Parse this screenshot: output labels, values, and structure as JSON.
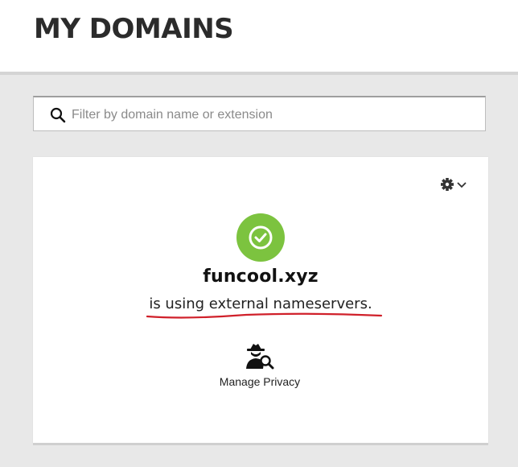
{
  "header": {
    "title": "MY DOMAINS"
  },
  "search": {
    "placeholder": "Filter by domain name or extension",
    "icon": "search-icon"
  },
  "domain_card": {
    "domain": "funcool.xyz",
    "status_text": "is using external nameservers.",
    "status_icon": "check-circle-icon",
    "status_color": "#7cc33f",
    "settings_icon": "gear-icon",
    "actions": [
      {
        "label": "Manage Privacy",
        "icon": "spy-search-icon"
      }
    ]
  },
  "colors": {
    "background": "#e8e8e8",
    "card": "#ffffff",
    "annotation_underline": "#d0202a"
  }
}
